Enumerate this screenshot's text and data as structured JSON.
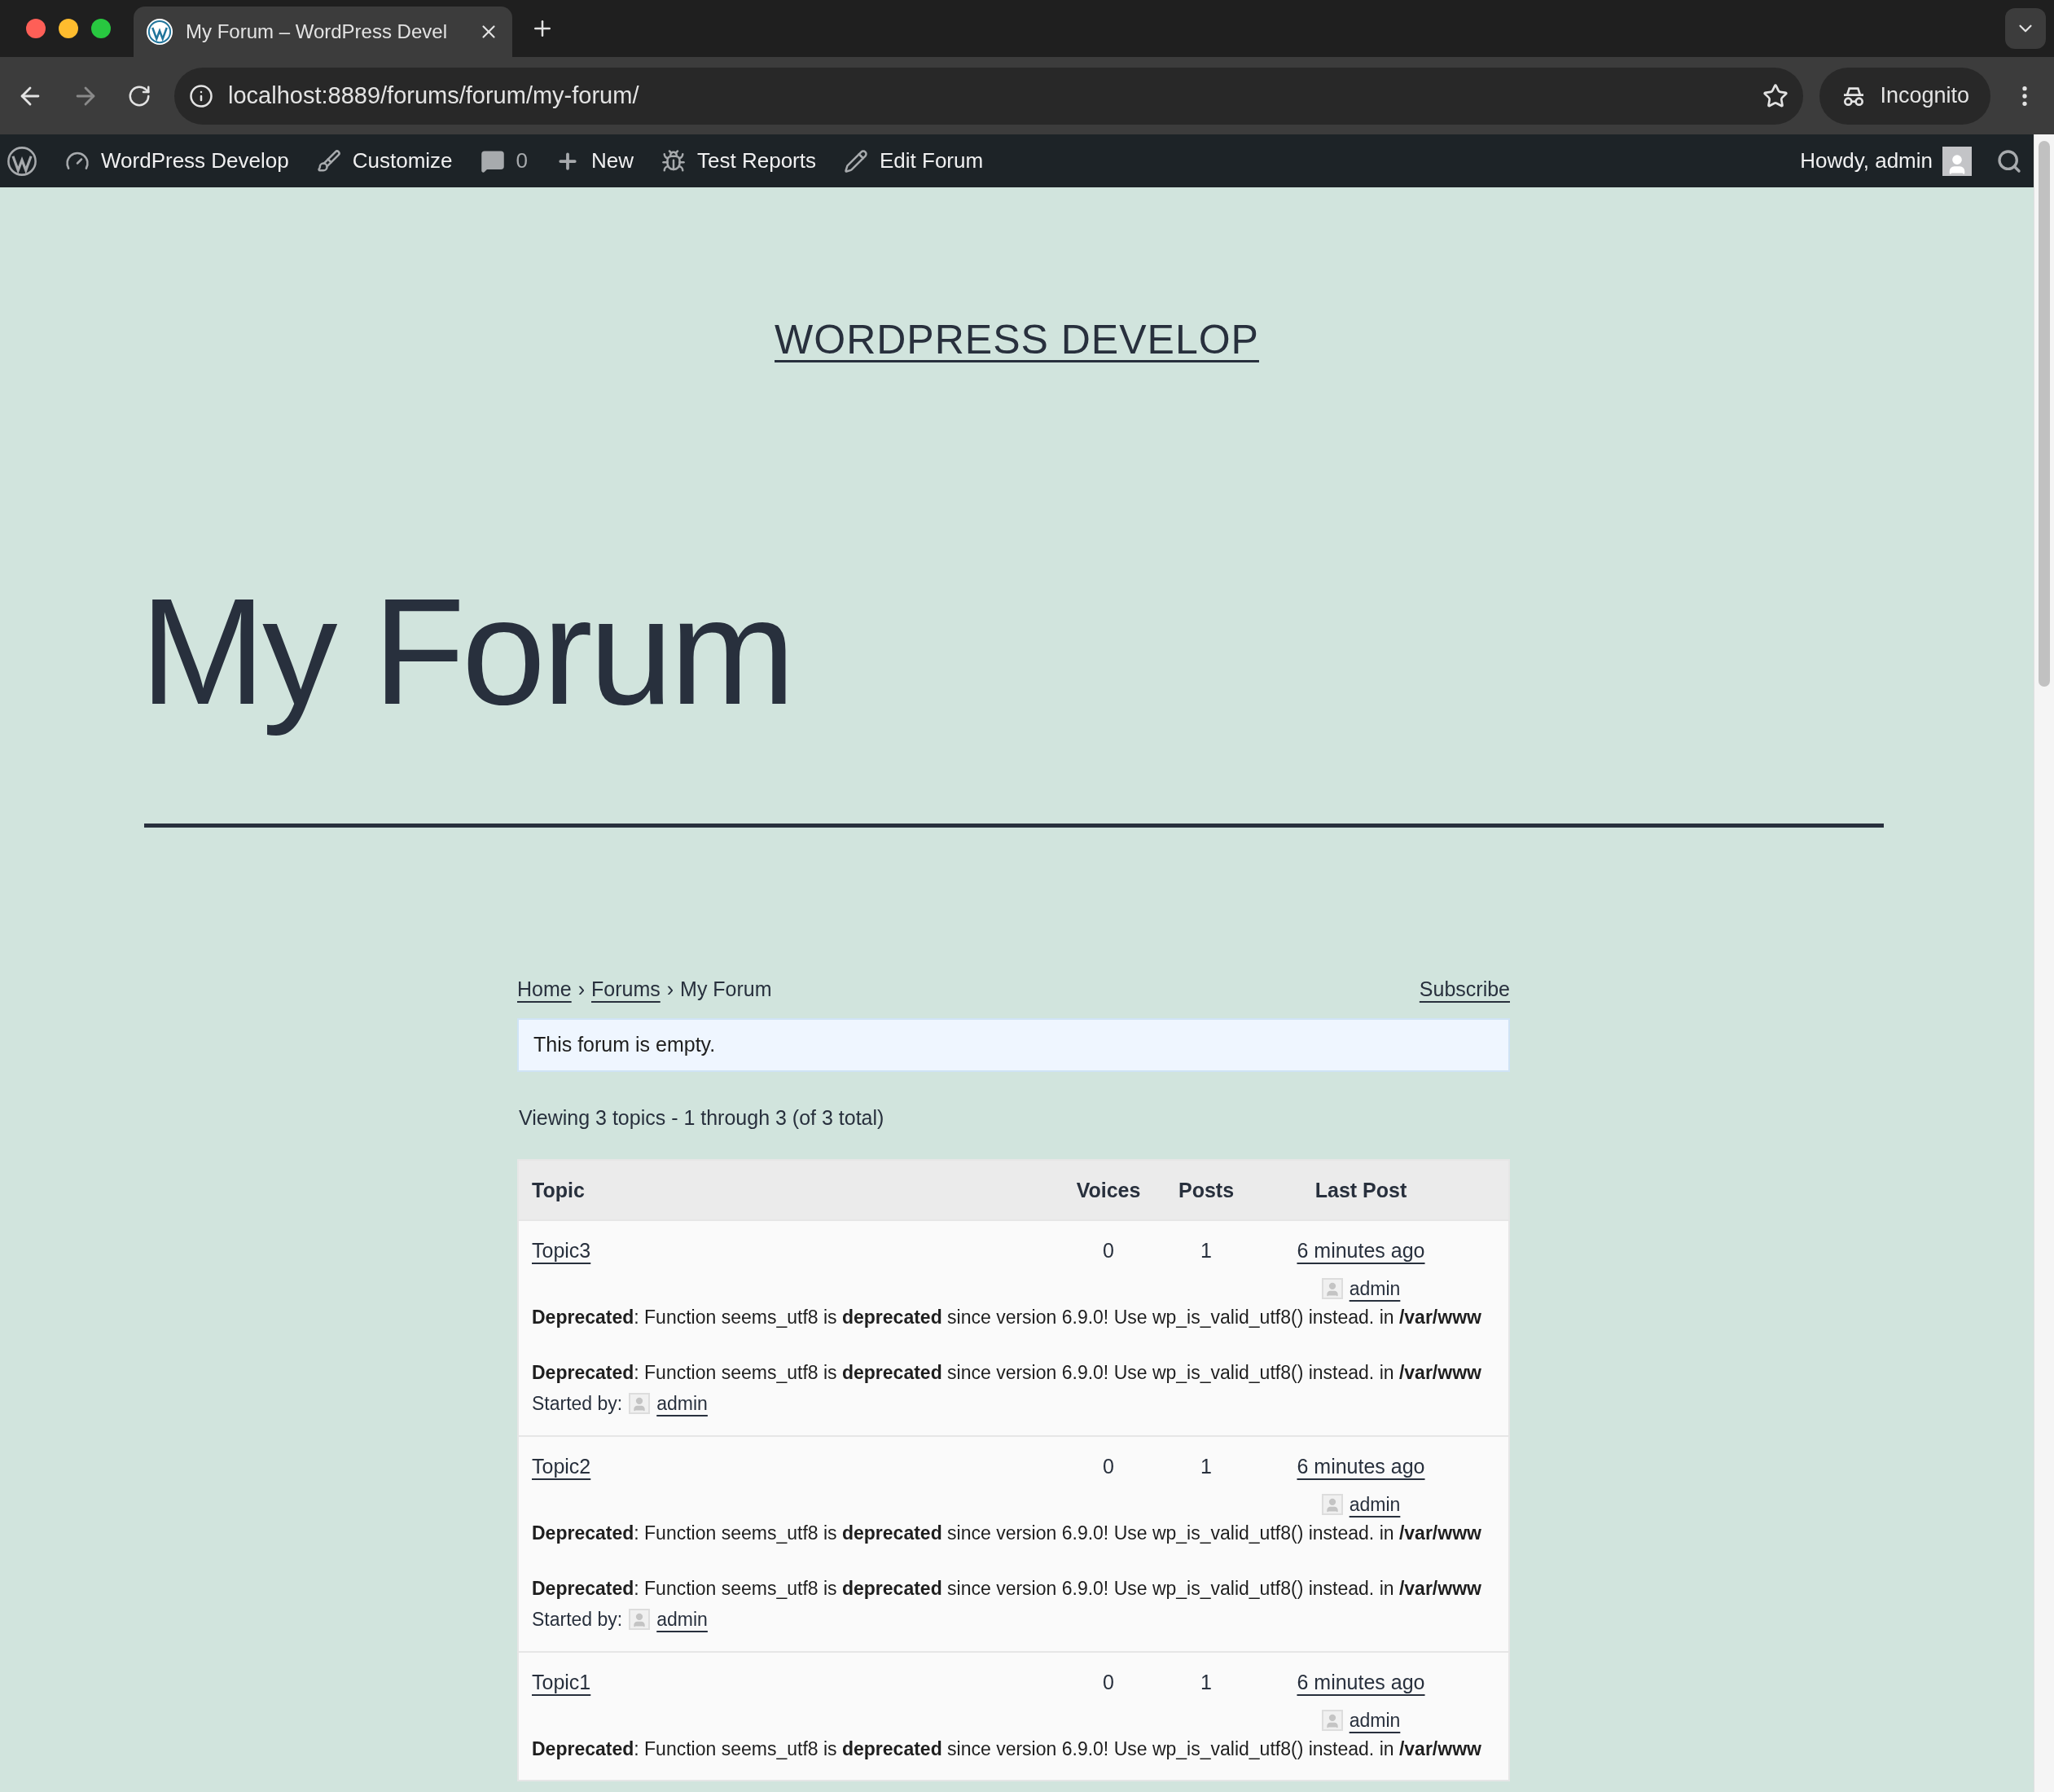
{
  "browser": {
    "tab_title": "My Forum – WordPress Devel",
    "url": "localhost:8889/forums/forum/my-forum/",
    "profile": "Incognito"
  },
  "admin_bar": {
    "items": [
      {
        "kind": "site",
        "label": "WordPress Develop"
      },
      {
        "kind": "customize",
        "label": "Customize"
      },
      {
        "kind": "comments",
        "label": "0"
      },
      {
        "kind": "new",
        "label": "New"
      },
      {
        "kind": "reports",
        "label": "Test Reports"
      },
      {
        "kind": "edit",
        "label": "Edit Forum"
      }
    ],
    "account": "Howdy, admin"
  },
  "site_title": "WORDPRESS DEVELOP",
  "page_title": "My Forum",
  "breadcrumbs": {
    "separator": "›",
    "items": [
      {
        "label": "Home",
        "link": true
      },
      {
        "label": "Forums",
        "link": true
      },
      {
        "label": "My Forum",
        "link": false
      }
    ]
  },
  "subscribe": "Subscribe",
  "notice": "This forum is empty.",
  "pagination_count": "Viewing 3 topics - 1 through 3 (of 3 total)",
  "table": {
    "columns": [
      "Topic",
      "Voices",
      "Posts",
      "Last Post"
    ],
    "rows": [
      {
        "topic": "Topic3",
        "voices": "0",
        "posts": "1",
        "last_post": "6 minutes ago",
        "last_author": "admin",
        "notices": [
          "**Deprecated**: Function seems_utf8 is **deprecated** since version 6.9.0! Use wp_is_valid_utf8() instead. in **/var/www**",
          "**Deprecated**: Function seems_utf8 is **deprecated** since version 6.9.0! Use wp_is_valid_utf8() instead. in **/var/www**"
        ],
        "started_by_label": "Started by:",
        "started_by": "admin"
      },
      {
        "topic": "Topic2",
        "voices": "0",
        "posts": "1",
        "last_post": "6 minutes ago",
        "last_author": "admin",
        "notices": [
          "**Deprecated**: Function seems_utf8 is **deprecated** since version 6.9.0! Use wp_is_valid_utf8() instead. in **/var/www**",
          "**Deprecated**: Function seems_utf8 is **deprecated** since version 6.9.0! Use wp_is_valid_utf8() instead. in **/var/www**"
        ],
        "started_by_label": "Started by:",
        "started_by": "admin"
      },
      {
        "topic": "Topic1",
        "voices": "0",
        "posts": "1",
        "last_post": "6 minutes ago",
        "last_author": "admin",
        "notices": [
          "**Deprecated**: Function seems_utf8 is **deprecated** since version 6.9.0! Use wp_is_valid_utf8() instead. in **/var/www**"
        ]
      }
    ]
  }
}
